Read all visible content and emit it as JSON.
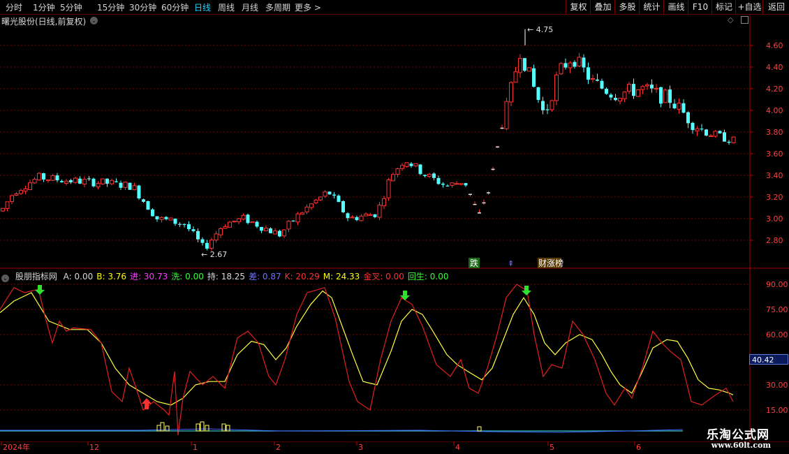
{
  "toolbar": {
    "periods": [
      "分时",
      "1分钟",
      "5分钟",
      "15分钟",
      "30分钟",
      "60分钟",
      "日线",
      "周线",
      "月线",
      "多周期",
      "更多 >"
    ],
    "active_period": "日线",
    "right_buttons": [
      "复权",
      "叠加",
      "多股",
      "统计",
      "画线",
      "F10",
      "标记",
      "+自选",
      "返回"
    ]
  },
  "stock": {
    "title": "曙光股份(日线,前复权)"
  },
  "price_axis": {
    "labels": [
      "4.60",
      "4.40",
      "4.20",
      "4.00",
      "3.80",
      "3.60",
      "3.40",
      "3.20",
      "3.00",
      "2.80"
    ],
    "values": [
      4.6,
      4.4,
      4.2,
      4.0,
      3.8,
      3.6,
      3.4,
      3.2,
      3.0,
      2.8
    ]
  },
  "annotations": {
    "high": "4.75",
    "low": "2.67",
    "signal_fall": "跌",
    "signal_up": "⇞",
    "signal_board": "财涨榜"
  },
  "indicator": {
    "name": "股朋指标网",
    "fields": [
      {
        "label": "A:",
        "value": "0.00",
        "color": "#d8d8d8"
      },
      {
        "label": "B:",
        "value": "3.76",
        "color": "#ffff00"
      },
      {
        "label": "进:",
        "value": "30.73",
        "color": "#ff3cff"
      },
      {
        "label": "洗:",
        "value": "0.00",
        "color": "#38ff38"
      },
      {
        "label": "持:",
        "value": "18.25",
        "color": "#d8d8d8"
      },
      {
        "label": "差:",
        "value": "0.87",
        "color": "#7070ff"
      },
      {
        "label": "K:",
        "value": "20.29",
        "color": "#ff3030"
      },
      {
        "label": "M:",
        "value": "24.33",
        "color": "#ffff00"
      },
      {
        "label": "金叉:",
        "value": "0.00",
        "color": "#ff3030"
      },
      {
        "label": "回生:",
        "value": "0.00",
        "color": "#38ff38"
      }
    ],
    "axis_labels": [
      "90.00",
      "75.00",
      "60.00",
      "30.00",
      "15.00"
    ],
    "axis_values": [
      90,
      75,
      60,
      30,
      15
    ],
    "current_value": "40.42"
  },
  "date_axis": {
    "labels": [
      "2024年",
      "12",
      "1",
      "2",
      "3",
      "4",
      "5",
      "6"
    ]
  },
  "watermark": {
    "line1": "乐淘公式网",
    "line2": "www.60lt.com"
  },
  "colors": {
    "up": "#ff3232",
    "down": "#54ffff",
    "k_line": "#e02020",
    "m_line": "#ffff40",
    "grid": "#7a0000",
    "active": "#18d6ff"
  },
  "chart_data": {
    "type": "candlestick",
    "series": [
      {
        "name": "K",
        "color": "#e02020"
      },
      {
        "name": "M",
        "color": "#ffff40"
      }
    ],
    "price_range": [
      2.67,
      4.75
    ],
    "indicator_range": [
      0,
      100
    ],
    "anchors": [
      {
        "label": "low",
        "value": 2.67
      },
      {
        "label": "high",
        "value": 4.75
      }
    ]
  }
}
